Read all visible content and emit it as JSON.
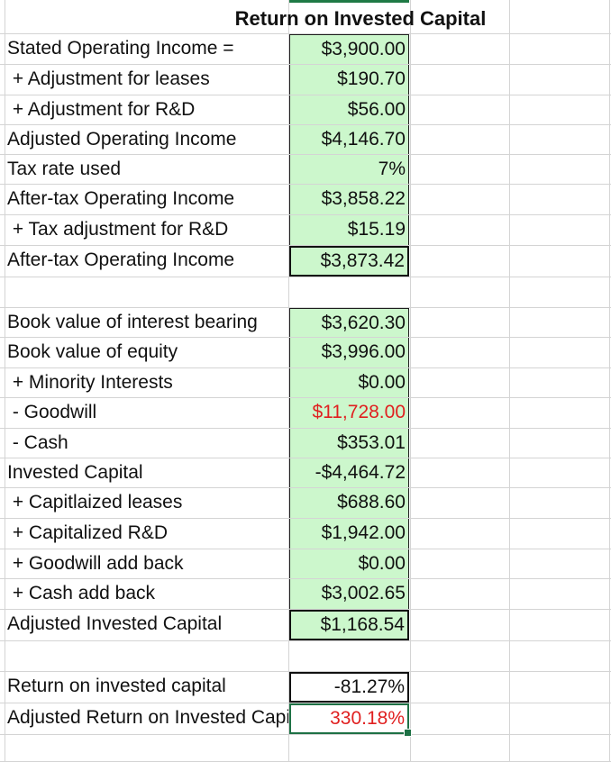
{
  "title": "Return on Invested Capital",
  "rows": [
    {
      "label": "Stated Operating Income =",
      "value": "$3,900.00"
    },
    {
      "label": " + Adjustment for leases",
      "value": "$190.70"
    },
    {
      "label": " + Adjustment for R&D",
      "value": "$56.00"
    },
    {
      "label": "Adjusted Operating Income",
      "value": "$4,146.70"
    },
    {
      "label": "Tax rate used",
      "value": "7%"
    },
    {
      "label": "After-tax Operating Income",
      "value": "$3,858.22"
    },
    {
      "label": " + Tax adjustment for R&D",
      "value": "$15.19"
    },
    {
      "label": "After-tax Operating Income",
      "value": "$3,873.42"
    },
    {
      "label": "Book value of interest bearing",
      "value": "$3,620.30"
    },
    {
      "label": "Book value of equity",
      "value": "$3,996.00"
    },
    {
      "label": " + Minority Interests",
      "value": "$0.00"
    },
    {
      "label": " - Goodwill",
      "value": "$11,728.00"
    },
    {
      "label": " - Cash",
      "value": "$353.01"
    },
    {
      "label": "Invested Capital",
      "value": "-$4,464.72"
    },
    {
      "label": " + Capitlaized leases",
      "value": "$688.60"
    },
    {
      "label": " + Capitalized R&D",
      "value": "$1,942.00"
    },
    {
      "label": " + Goodwill add back",
      "value": "$0.00"
    },
    {
      "label": " + Cash add back",
      "value": "$3,002.65"
    },
    {
      "label": "Adjusted Invested Capital",
      "value": "$1,168.54"
    },
    {
      "label": "Return on invested capital",
      "value": "-81.27%"
    },
    {
      "label": "Adjusted Return on Invested Capital",
      "value": "330.18%"
    }
  ],
  "colors": {
    "green_fill": "#ccf7cc",
    "red_text": "#e02020",
    "selection": "#1e7145",
    "gridline": "#d4d4d4"
  }
}
